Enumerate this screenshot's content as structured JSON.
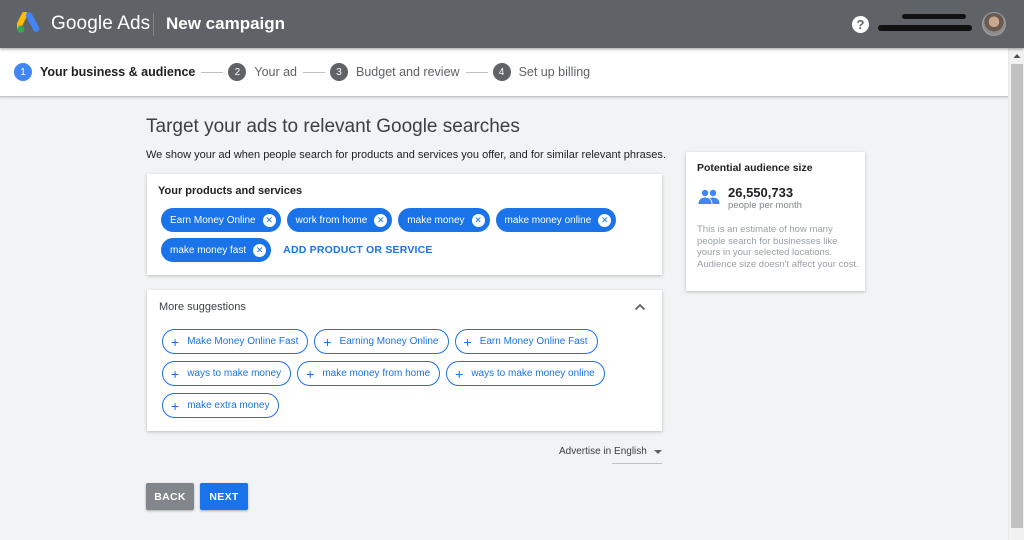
{
  "appbar": {
    "brand": "Google Ads",
    "title": "New campaign",
    "help_icon": "help-circle-icon",
    "help_glyph": "?",
    "account": {
      "redacted": true
    }
  },
  "stepper": {
    "steps": [
      {
        "number": "1",
        "label": "Your business & audience",
        "active": true
      },
      {
        "number": "2",
        "label": "Your ad",
        "active": false
      },
      {
        "number": "3",
        "label": "Budget and review",
        "active": false
      },
      {
        "number": "4",
        "label": "Set up billing",
        "active": false
      }
    ]
  },
  "main": {
    "title": "Target your ads to relevant Google searches",
    "subtitle": "We show your ad when people search for products and services you offer, and for similar relevant phrases."
  },
  "products": {
    "heading": "Your products and services",
    "chips": [
      {
        "label": "Earn Money Online"
      },
      {
        "label": "work from home"
      },
      {
        "label": "make money"
      },
      {
        "label": "make money online"
      },
      {
        "label": "make money fast"
      }
    ],
    "remove_glyph": "✕",
    "add_label": "ADD PRODUCT OR SERVICE"
  },
  "suggestions": {
    "heading": "More suggestions",
    "expanded": true,
    "add_glyph": "+",
    "items": [
      {
        "label": "Make Money Online Fast"
      },
      {
        "label": "Earning Money Online"
      },
      {
        "label": "Earn Money Online Fast"
      },
      {
        "label": "ways to make money"
      },
      {
        "label": "make money from home"
      },
      {
        "label": "ways to make money online"
      },
      {
        "label": "make extra money"
      }
    ]
  },
  "language": {
    "selected": "Advertise in English"
  },
  "actions": {
    "back_label": "BACK",
    "next_label": "NEXT"
  },
  "audience": {
    "heading": "Potential audience size",
    "count": "26,550,733",
    "unit": "people per month",
    "note": "This is an estimate of how many people search for businesses like yours in your selected locations. Audience size doesn't affect your cost."
  },
  "colors": {
    "appbar": "#5f6368",
    "primary": "#1a73e8",
    "step_active": "#4285f4",
    "back_button": "#80868b",
    "page_bg": "#f1f3f4"
  }
}
